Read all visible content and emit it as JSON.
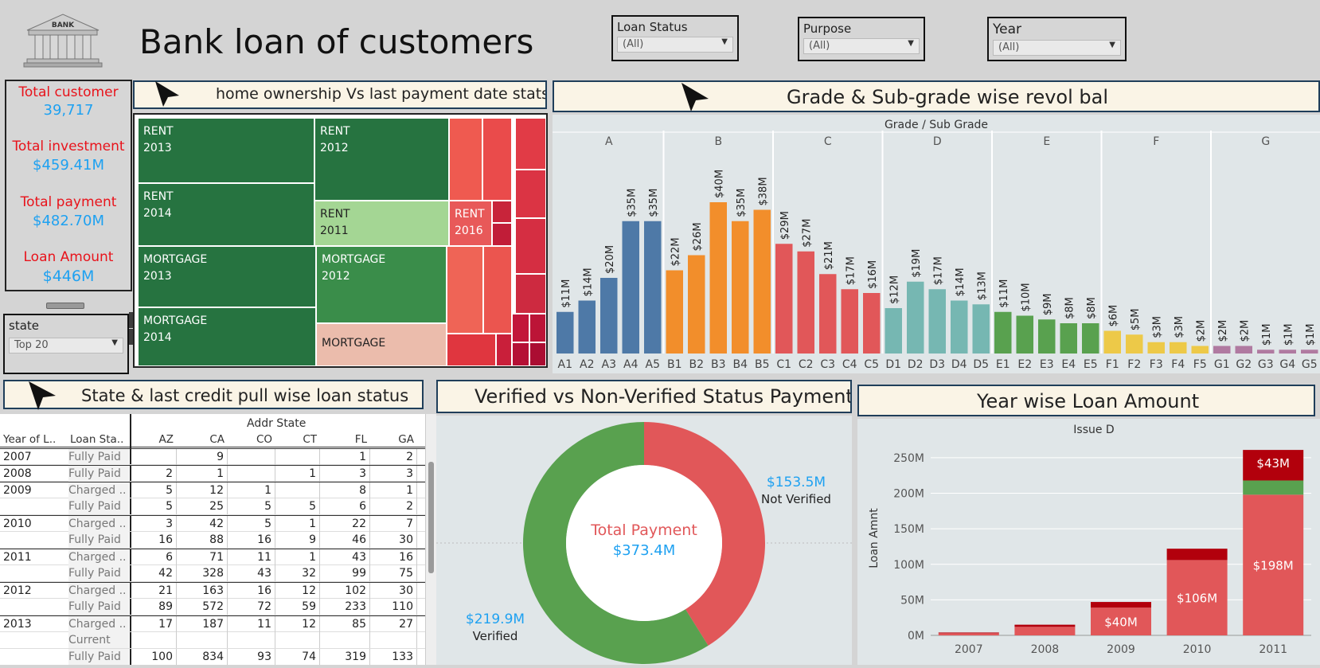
{
  "logo": {
    "text": "BANK"
  },
  "title": "Bank loan of customers",
  "filters": [
    {
      "label": "Loan Status",
      "value": "(All)"
    },
    {
      "label": "Purpose",
      "value": "(All)"
    },
    {
      "label": "Year",
      "value": "(All)"
    }
  ],
  "kpis": [
    {
      "label": "Total customer",
      "value": "39,717"
    },
    {
      "label": "Total investment",
      "value": "$459.41M"
    },
    {
      "label": "Total payment",
      "value": "$482.70M"
    },
    {
      "label": "Loan Amount",
      "value": "$446M"
    }
  ],
  "state_filter": {
    "label": "state",
    "value": "Top 20"
  },
  "panels": {
    "treemap": "home ownership Vs last payment date stats",
    "grade": "Grade & Sub-grade wise revol bal",
    "state": "State & last credit pull wise loan status",
    "verified": "Verified vs Non-Verified Status Payment",
    "year": "Year wise Loan Amount"
  },
  "treemap": [
    {
      "line1": "RENT",
      "line2": "2013",
      "color": "#267340"
    },
    {
      "line1": "RENT",
      "line2": "2012",
      "color": "#267340"
    },
    {
      "line1": "RENT",
      "line2": "2014",
      "color": "#267340"
    },
    {
      "line1": "RENT",
      "line2": "2011",
      "color": "#a4d694"
    },
    {
      "line1": "RENT",
      "line2": "2016",
      "color": "#e85959"
    },
    {
      "line1": "MORTGAGE",
      "line2": "2013",
      "color": "#267340"
    },
    {
      "line1": "MORTGAGE",
      "line2": "2012",
      "color": "#3a8d4a"
    },
    {
      "line1": "MORTGAGE",
      "line2": "2014",
      "color": "#267340"
    },
    {
      "line1": "MORTGAGE",
      "line2": "",
      "color": "#ebbcac"
    }
  ],
  "chart_data": [
    {
      "type": "bar",
      "title": "Grade / Sub Grade",
      "groups": [
        {
          "name": "A",
          "color": "#4e79a7"
        },
        {
          "name": "B",
          "color": "#f28e2b"
        },
        {
          "name": "C",
          "color": "#e15759"
        },
        {
          "name": "D",
          "color": "#76b7b2"
        },
        {
          "name": "E",
          "color": "#59a14f"
        },
        {
          "name": "F",
          "color": "#edc948"
        },
        {
          "name": "G",
          "color": "#b07aa1"
        }
      ],
      "categories": [
        "A1",
        "A2",
        "A3",
        "A4",
        "A5",
        "B1",
        "B2",
        "B3",
        "B4",
        "B5",
        "C1",
        "C2",
        "C3",
        "C4",
        "C5",
        "D1",
        "D2",
        "D3",
        "D4",
        "D5",
        "E1",
        "E2",
        "E3",
        "E4",
        "E5",
        "F1",
        "F2",
        "F3",
        "F4",
        "F5",
        "G1",
        "G2",
        "G3",
        "G4",
        "G5"
      ],
      "values": [
        11,
        14,
        20,
        35,
        35,
        22,
        26,
        40,
        35,
        38,
        29,
        27,
        21,
        17,
        16,
        12,
        19,
        17,
        14,
        13,
        11,
        10,
        9,
        8,
        8,
        6,
        5,
        3,
        3,
        2,
        2,
        2,
        1,
        1,
        1
      ],
      "labels": [
        "$11M",
        "$14M",
        "$20M",
        "$35M",
        "$35M",
        "$22M",
        "$26M",
        "$40M",
        "$35M",
        "$38M",
        "$29M",
        "$27M",
        "$21M",
        "$17M",
        "$16M",
        "$12M",
        "$19M",
        "$17M",
        "$14M",
        "$13M",
        "$11M",
        "$10M",
        "$9M",
        "$8M",
        "$8M",
        "$6M",
        "$5M",
        "$3M",
        "$3M",
        "$2M",
        "$2M",
        "$2M",
        "$1M",
        "$1M",
        "$1M"
      ]
    },
    {
      "type": "pie",
      "title": "Total Payment",
      "center_value": "$373.4M",
      "slices": [
        {
          "name": "Not Verified",
          "label": "$153.5M",
          "value": 153.5,
          "color": "#e15759"
        },
        {
          "name": "Verified",
          "label": "$219.9M",
          "value": 219.9,
          "color": "#59a14f"
        }
      ]
    },
    {
      "type": "bar",
      "title": "Issue D",
      "ylabel": "Loan Amnt",
      "ylim": [
        0,
        260
      ],
      "yticks": [
        "0M",
        "50M",
        "100M",
        "150M",
        "200M",
        "250M"
      ],
      "categories": [
        "2007",
        "2008",
        "2009",
        "2010",
        "2011"
      ],
      "series": [
        {
          "values": [
            3,
            12,
            39,
            106,
            198
          ],
          "color": "#e15759"
        },
        {
          "values": [
            0,
            0,
            0,
            0,
            20
          ],
          "color": "#59a14f"
        },
        {
          "values": [
            1,
            3,
            8,
            16,
            43
          ],
          "color": "#b2000c"
        }
      ],
      "labels": [
        "",
        "",
        "$40M",
        "$106M",
        "$198M"
      ],
      "top_labels": [
        "",
        "",
        "",
        "",
        "$43M"
      ]
    }
  ],
  "state_table": {
    "col_group": "Addr State",
    "headers": [
      "Year of L..",
      "Loan Sta..",
      "AZ",
      "CA",
      "CO",
      "CT",
      "FL",
      "GA"
    ],
    "rows": [
      [
        "2007",
        "Fully Paid",
        "",
        "9",
        "",
        "",
        "1",
        "2"
      ],
      [
        "2008",
        "Fully Paid",
        "2",
        "1",
        "",
        "1",
        "3",
        "3"
      ],
      [
        "2009",
        "Charged ..",
        "5",
        "12",
        "1",
        "",
        "8",
        "1"
      ],
      [
        "",
        "Fully Paid",
        "5",
        "25",
        "5",
        "5",
        "6",
        "2"
      ],
      [
        "2010",
        "Charged ..",
        "3",
        "42",
        "5",
        "1",
        "22",
        "7"
      ],
      [
        "",
        "Fully Paid",
        "16",
        "88",
        "16",
        "9",
        "46",
        "30"
      ],
      [
        "2011",
        "Charged ..",
        "6",
        "71",
        "11",
        "1",
        "43",
        "16"
      ],
      [
        "",
        "Fully Paid",
        "42",
        "328",
        "43",
        "32",
        "99",
        "75"
      ],
      [
        "2012",
        "Charged ..",
        "21",
        "163",
        "16",
        "12",
        "102",
        "30"
      ],
      [
        "",
        "Fully Paid",
        "89",
        "572",
        "72",
        "59",
        "233",
        "110"
      ],
      [
        "2013",
        "Charged ..",
        "17",
        "187",
        "11",
        "12",
        "85",
        "27"
      ],
      [
        "",
        "Current",
        "",
        "",
        "",
        "",
        "",
        ""
      ],
      [
        "",
        "Fully Paid",
        "100",
        "834",
        "93",
        "74",
        "319",
        "133"
      ]
    ]
  }
}
